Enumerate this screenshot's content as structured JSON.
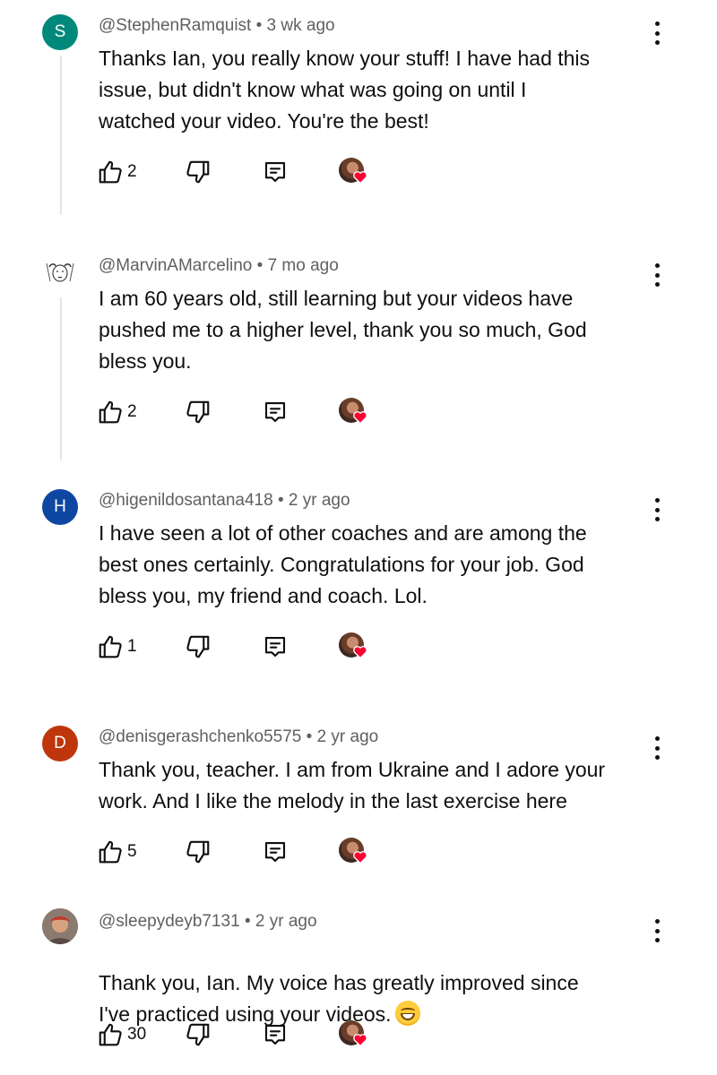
{
  "colors": {
    "avatar_s": "#00897b",
    "avatar_h": "#0d47a1",
    "avatar_d": "#bf360c",
    "heart": "#ff0033",
    "text": "#0f0f0f",
    "meta": "#606060"
  },
  "comments": [
    {
      "avatar_letter": "S",
      "author": "@StephenRamquist",
      "time": "3 wk ago",
      "text": "Thanks Ian, you really know your stuff! I have had this\nissue, but didn't know what was going on until I\nwatched your video. You're the best!",
      "likes": "2"
    },
    {
      "avatar_letter": "",
      "author": "@MarvinAMarcelino",
      "time": "7 mo ago",
      "text": "I am 60 years old,  still learning but your videos have\npushed me to a higher level, thank you so much, God\nbless you.",
      "likes": "2"
    },
    {
      "avatar_letter": "H",
      "author": "@higenildosantana418",
      "time": "2 yr ago",
      "text": "I have seen a lot of other coaches and are among the\nbest ones certainly. Congratulations for your job. God\nbless you, my friend and coach. Lol.",
      "likes": "1"
    },
    {
      "avatar_letter": "D",
      "author": "@denisgerashchenko5575",
      "time": "2 yr ago",
      "text": "Thank you, teacher. I am from Ukraine and I adore your\nwork. And I like the melody in the last exercise here",
      "likes": "5"
    },
    {
      "avatar_letter": "",
      "author": "@sleepydeyb7131",
      "time": "2 yr ago",
      "text": "Thank you, Ian. My voice has greatly improved since\nI've practiced using your videos.",
      "likes": "30"
    }
  ],
  "separator": "•",
  "icons": {
    "like": "thumbs-up-icon",
    "dislike": "thumbs-down-icon",
    "reply": "reply-comment-icon",
    "hearted": "creator-heart-icon",
    "more": "more-vertical-icon",
    "emoji": "grinning-face-emoji"
  }
}
